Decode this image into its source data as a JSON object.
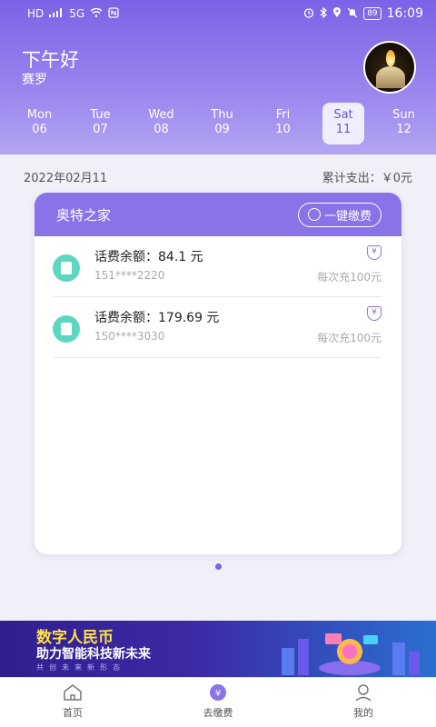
{
  "status_bar": {
    "left_items": [
      "HD",
      "5G",
      "WiFi",
      "NFC"
    ],
    "battery": "89",
    "time": "16:09"
  },
  "header": {
    "greeting": "下午好",
    "username": "赛罗",
    "days": [
      {
        "weekday": "Mon",
        "date": "06",
        "active": false
      },
      {
        "weekday": "Tue",
        "date": "07",
        "active": false
      },
      {
        "weekday": "Wed",
        "date": "08",
        "active": false
      },
      {
        "weekday": "Thu",
        "date": "09",
        "active": false
      },
      {
        "weekday": "Fri",
        "date": "10",
        "active": false
      },
      {
        "weekday": "Sat",
        "date": "11",
        "active": true
      },
      {
        "weekday": "Sun",
        "date": "12",
        "active": false
      }
    ]
  },
  "summary": {
    "date": "2022年02月11",
    "total_label": "累计支出：",
    "total_value": "￥0元"
  },
  "card": {
    "title": "奥特之家",
    "pay_button": "一键缴费",
    "rows": [
      {
        "balance_label": "话费余额：",
        "balance_value": "84.1 元",
        "phone": "151****2220",
        "rule": "每次充100元"
      },
      {
        "balance_label": "话费余额：",
        "balance_value": "179.69 元",
        "phone": "150****3030",
        "rule": "每次充100元"
      }
    ]
  },
  "banner": {
    "title": "数字人民币",
    "subtitle": "助力智能科技新未来",
    "small": "共创未来新形态"
  },
  "nav": {
    "home": "首页",
    "pay": "去缴费",
    "me": "我的"
  },
  "colors": {
    "accent": "#7c62e6",
    "card_header": "#8a72e8",
    "phone_icon": "#5ed7c0"
  }
}
